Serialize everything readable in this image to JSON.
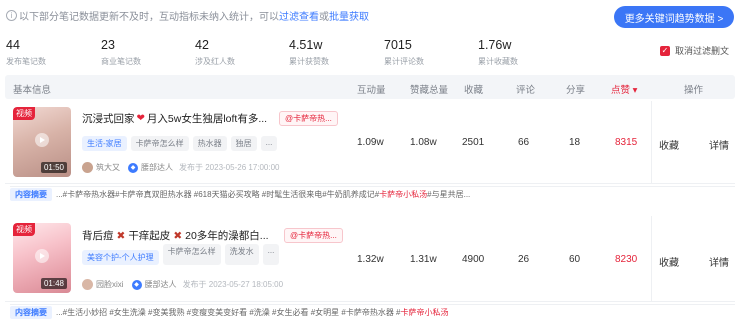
{
  "notice": {
    "icon": "info-icon",
    "text": "以下部分笔记数据更新不及时，互动指标未纳入统计，可以",
    "link1": "过滤查看",
    "or": "或",
    "link2": "批量获取"
  },
  "more_button": "更多关键词趋势数据 >",
  "stats": [
    {
      "value": "44",
      "label": "发布笔记数"
    },
    {
      "value": "23",
      "label": "商业笔记数"
    },
    {
      "value": "42",
      "label": "涉及红人数"
    },
    {
      "value": "4.51w",
      "label": "累计获赞数"
    },
    {
      "value": "7015",
      "label": "累计评论数"
    },
    {
      "value": "1.76w",
      "label": "累计收藏数"
    }
  ],
  "filter": {
    "checked": true,
    "label": "取消过滤删文"
  },
  "table": {
    "headers": {
      "basic": "基本信息",
      "interaction": "互动量",
      "likes_total": "赞藏总量",
      "favorites": "收藏",
      "comments": "评论",
      "shares": "分享",
      "likes": "点赞 ▾",
      "actions": "操作"
    }
  },
  "rows": [
    {
      "badge": "视频",
      "duration": "01:50",
      "title_a": "沉浸式回家",
      "title_emoji": "❤",
      "title_b": "月入5w女生独居loft有多...",
      "brand_tag": "@卡萨帝热...",
      "tags": [
        "生活-家居",
        "卡萨帝怎么样",
        "热水器",
        "独居",
        "..."
      ],
      "author": "筑大又",
      "level": "腰部达人",
      "date": "发布于 2023-05-26 17:00:00",
      "interaction": "1.09w",
      "likes_total": "1.08w",
      "favorites": "2501",
      "comments": "66",
      "shares": "18",
      "likes": "8315",
      "fav_action": "收藏",
      "detail_action": "详情",
      "content_label": "内容摘要",
      "content_a": "...#卡萨帝热水器#卡萨帝真双胆热水器 #618天猫必买攻略 #时髦生活很来电#牛奶肌养成记#",
      "content_red": "卡萨帝小私汤",
      "content_b": "#与星共居..."
    },
    {
      "badge": "视频",
      "duration": "01:48",
      "title_a": "背后痘",
      "title_emoji": "✖",
      "title_b": "干痒起皮",
      "title_emoji2": "✖",
      "title_c": "20多年的澡都白...",
      "brand_tag": "@卡萨帝热...",
      "tags": [
        "美容个护-个人护理",
        "卡萨帝怎么样",
        "洗发水",
        "..."
      ],
      "author": "园脸xixi",
      "level": "腰部达人",
      "date": "发布于 2023-05-27 18:05:00",
      "interaction": "1.32w",
      "likes_total": "1.31w",
      "favorites": "4900",
      "comments": "26",
      "shares": "60",
      "likes": "8230",
      "fav_action": "收藏",
      "detail_action": "详情",
      "content_label": "内容摘要",
      "content_a": "...#生活小妙招 #女生洗澡 #变美我熟 #变瘦变美变好看 #洗澡 #女生必看 #女明星 #卡萨帝热水器 #",
      "content_red": "卡萨帝小私汤",
      "content_b": ""
    }
  ],
  "colors": {
    "accent": "#3b76f6",
    "hot": "#e5243b"
  }
}
